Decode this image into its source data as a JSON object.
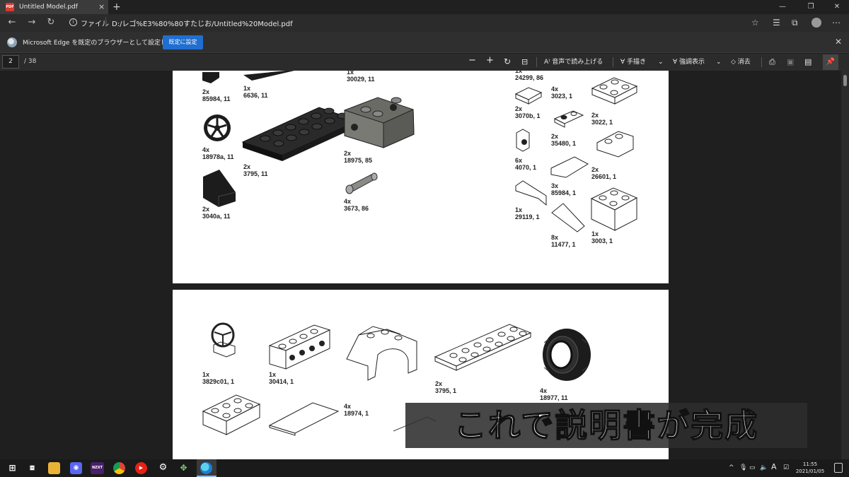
{
  "tab": {
    "title": "Untitled Model.pdf",
    "favicon": "pdf-icon",
    "close": "×",
    "new_tab": "+"
  },
  "window": {
    "minimize": "—",
    "restore": "❐",
    "close": "✕"
  },
  "address": {
    "scheme_label": "ファイル",
    "url": "D:/レゴ%E3%80%80すたじお/Untitled%20Model.pdf"
  },
  "infobar": {
    "message": "Microsoft Edge を既定のブラウザーとして設定しますか?",
    "button": "既定に設定",
    "close": "✕"
  },
  "pdf_toolbar": {
    "page": "2",
    "total": "/ 38",
    "read_aloud": "音声で読み上げる",
    "draw": "手描き",
    "highlight": "強調表示",
    "erase": "消去"
  },
  "page_top_parts": [
    {
      "label": "1x\n30029, 11",
      "shape": "none"
    },
    {
      "label": "2x\n85984, 11",
      "shape": "slope-dark"
    },
    {
      "label": "1x\n6636, 11",
      "shape": "tile-dark"
    },
    {
      "label": "4x\n18978a, 11",
      "shape": "wheel-dark"
    },
    {
      "label": "2x\n3795, 11",
      "shape": "plate-2x6-dark"
    },
    {
      "label": "2x\n18975, 85",
      "shape": "bracket-gray"
    },
    {
      "label": "2x\n3040a, 11",
      "shape": "slope45-dark"
    },
    {
      "label": "4x\n3673, 86",
      "shape": "pin-gray"
    },
    {
      "label": "1x\n24299, 86",
      "shape": "none"
    },
    {
      "label": "4x\n3023, 1",
      "shape": "plate-1x2"
    },
    {
      "label": "2x\n3070b, 1",
      "shape": "tile-1x1"
    },
    {
      "label": "2x\n3022, 1",
      "shape": "plate-2x2"
    },
    {
      "label": "2x\n35480, 1",
      "shape": "plate-rounded"
    },
    {
      "label": "6x\n4070, 1",
      "shape": "brick-headlight"
    },
    {
      "label": "2x\n26601, 1",
      "shape": "wedge-plate"
    },
    {
      "label": "3x\n85984, 1",
      "shape": "slope-tile"
    },
    {
      "label": "1x\n29119, 1",
      "shape": "wedge-tile"
    },
    {
      "label": "8x\n11477, 1",
      "shape": "curved-slope"
    },
    {
      "label": "1x\n3003, 1",
      "shape": "brick-2x2"
    }
  ],
  "page_bottom_parts": [
    {
      "label": "1x\n3829c01, 1",
      "shape": "steering-wheel"
    },
    {
      "label": "1x\n30414, 1",
      "shape": "brick-1x4-studs"
    },
    {
      "label": "4x\n18974, 1",
      "shape": "mudguard"
    },
    {
      "label": "2x\n3795, 1",
      "shape": "plate-2x6"
    },
    {
      "label": "4x\n18977, 11",
      "shape": "tire"
    }
  ],
  "subtitle": "これで説明書が完成",
  "taskbar": {
    "apps": [
      "windows-logo",
      "task-view",
      "file-explorer",
      "discord",
      "nzxt",
      "chrome",
      "youtube-music",
      "settings",
      "game",
      "edge"
    ],
    "nzxt_label": "NZXT",
    "ime": "A",
    "time": "11:55",
    "date": "2021/01/05"
  },
  "colors": {
    "accent": "#1f6fd1",
    "dark_part": "#1c1c1c",
    "gray_part": "#6b6b66"
  }
}
